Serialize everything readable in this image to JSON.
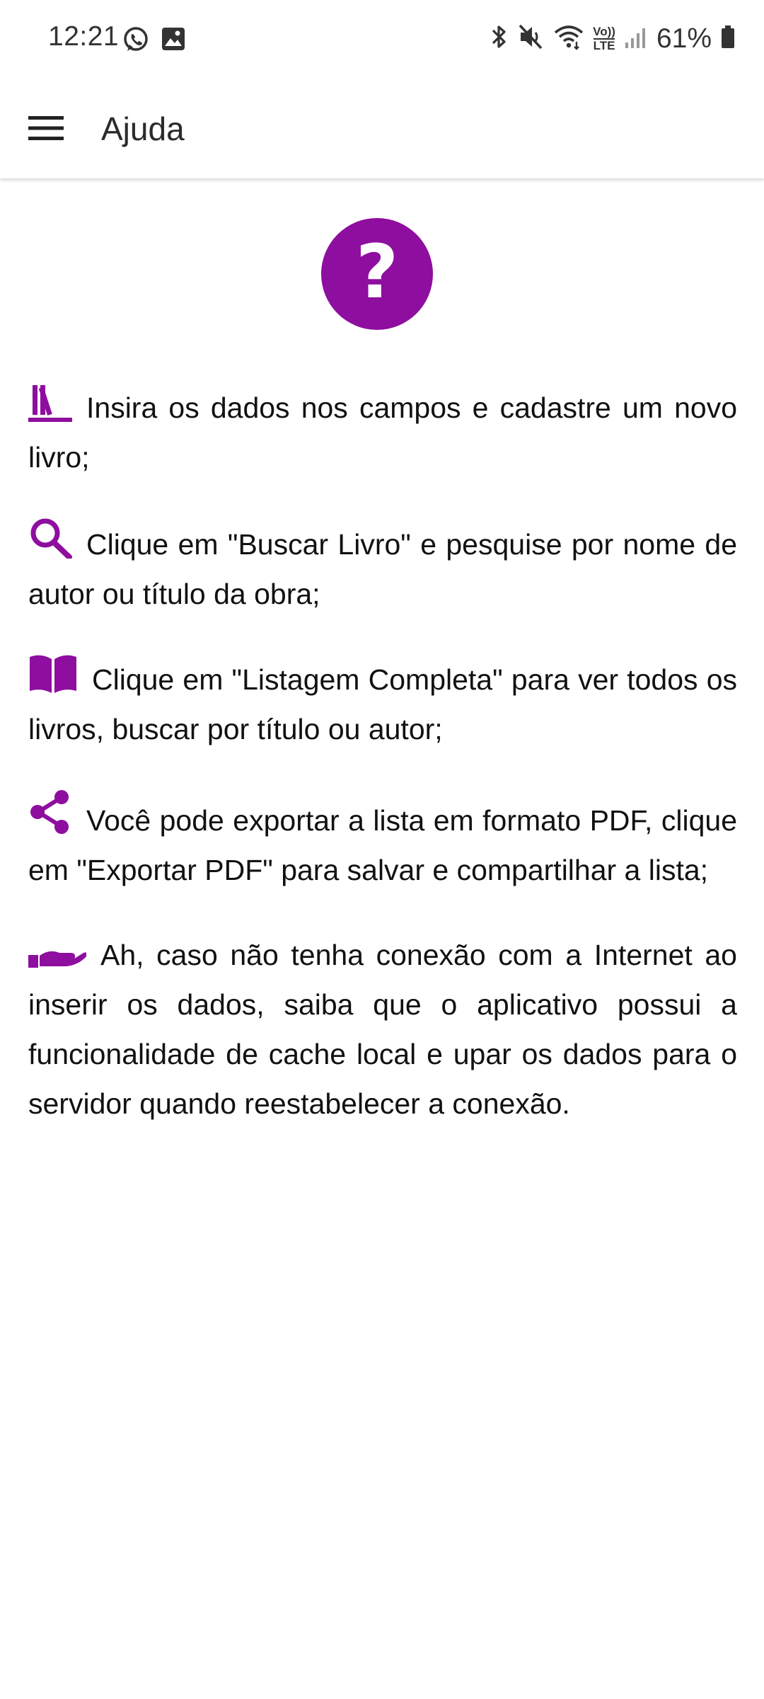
{
  "status_bar": {
    "time": "12:21",
    "left_icons": [
      "whatsapp-icon",
      "gallery-icon"
    ],
    "right_icons": [
      "bluetooth-icon",
      "mute-icon",
      "wifi-icon",
      "volte-icon",
      "signal-icon"
    ],
    "volte_label_top": "Vo))",
    "volte_label_bottom": "LTE",
    "battery_text": "61%"
  },
  "app_bar": {
    "title": "Ajuda",
    "menu_icon": "hamburger-menu-icon"
  },
  "colors": {
    "accent": "#8e0e9f",
    "text": "#111111",
    "background": "#ffffff"
  },
  "help": {
    "badge_glyph": "?",
    "items": [
      {
        "icon": "books-icon",
        "text": "Insira os dados nos campos e cadastre um novo livro;"
      },
      {
        "icon": "search-icon",
        "text": "Clique em \"Buscar Livro\" e pesquise por nome de autor ou título da obra;"
      },
      {
        "icon": "open-book-icon",
        "text": "Clique em \"Listagem Completa\" para ver todos os livros, buscar por título ou autor;"
      },
      {
        "icon": "share-icon",
        "text": "Você pode exportar a lista em formato PDF, clique em \"Exportar PDF\" para salvar e compartilhar a lista;"
      },
      {
        "icon": "hand-icon",
        "text": "Ah, caso não tenha conexão com a Internet ao inserir os dados, saiba que o aplicativo possui a funcionalidade de cache local e upar os dados para o servidor quando reestabelecer a conexão."
      }
    ]
  }
}
